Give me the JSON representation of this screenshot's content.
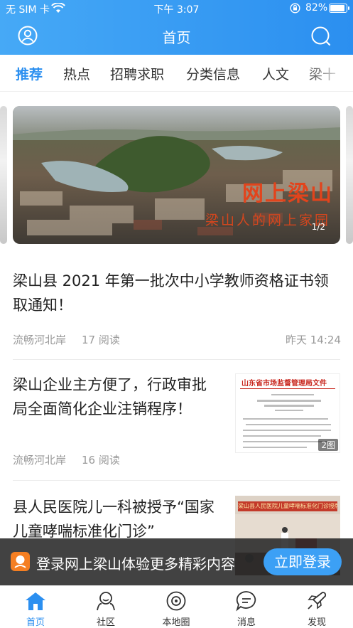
{
  "status_bar": {
    "carrier": "无 SIM 卡",
    "time": "下午 3:07",
    "battery": "82%",
    "battery_level": 0.82
  },
  "header": {
    "title": "首页",
    "left_icon": "user-icon",
    "right_icon": "search-icon"
  },
  "tabs": [
    "推荐",
    "热点",
    "招聘求职",
    "分类信息",
    "人文",
    "梁十"
  ],
  "banner": {
    "title": "网上梁山",
    "subtitle": "梁山人的网上家园",
    "page": "1/2"
  },
  "articles": [
    {
      "title": "梁山县 2021 年第一批次中小学教师资格证书领取通知！",
      "source": "流畅河北岸",
      "reads": "17 阅读",
      "time": "昨天 14:24"
    },
    {
      "title": "梁山企业主方便了，行政审批局全面简化企业注销程序！",
      "source": "流畅河北岸",
      "reads": "16 阅读",
      "thumb_heading": "山东省市场监督管理局文件",
      "thumb_badge": "2图"
    },
    {
      "title": "县人民医院儿一科被授予“国家儿童哮喘标准化门诊”",
      "thumb_banner": "梁山县人民医院儿童哮喘标准化门诊授牌仪式"
    }
  ],
  "login_prompt": {
    "message": "登录网上梁山体验更多精彩内容",
    "button": "立即登录"
  },
  "bottom_nav": [
    {
      "label": "首页",
      "icon": "home-icon",
      "active": true
    },
    {
      "label": "社区",
      "icon": "community-icon",
      "active": false
    },
    {
      "label": "本地圈",
      "icon": "local-circle-icon",
      "active": false
    },
    {
      "label": "消息",
      "icon": "message-icon",
      "active": false
    },
    {
      "label": "发现",
      "icon": "discover-icon",
      "active": false
    }
  ],
  "colors": {
    "accent": "#2b8ff0",
    "banner_title": "#e2441c",
    "login_button": "#3ca0f5"
  }
}
